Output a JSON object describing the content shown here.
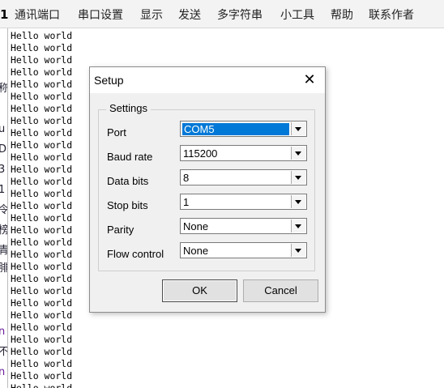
{
  "menubar": {
    "edge_char": "1",
    "items": [
      "通讯端口",
      "串口设置",
      "显示",
      "发送",
      "多字符串",
      "小工具",
      "帮助",
      "联系作者"
    ]
  },
  "left_strip": [
    "称",
    "u",
    "D",
    "3",
    "1",
    "令",
    "榜",
    "青",
    "腓",
    "n",
    "不",
    "n"
  ],
  "terminal": {
    "line_text": "Hello world",
    "visible_lines": 30
  },
  "dialog": {
    "title": "Setup",
    "close_glyph": "✕",
    "group_label": "Settings",
    "fields": [
      {
        "label": "Port",
        "value": "COM5",
        "selected": true
      },
      {
        "label": "Baud rate",
        "value": "115200",
        "selected": false
      },
      {
        "label": "Data bits",
        "value": "8",
        "selected": false
      },
      {
        "label": "Stop bits",
        "value": "1",
        "selected": false
      },
      {
        "label": "Parity",
        "value": "None",
        "selected": false
      },
      {
        "label": "Flow control",
        "value": "None",
        "selected": false
      }
    ],
    "ok_label": "OK",
    "cancel_label": "Cancel"
  },
  "icons": {
    "dropdown": "chevron-down-icon",
    "close": "close-icon"
  },
  "colors": {
    "selection": "#0078d7",
    "dialog_bg": "#f0f0f0"
  }
}
